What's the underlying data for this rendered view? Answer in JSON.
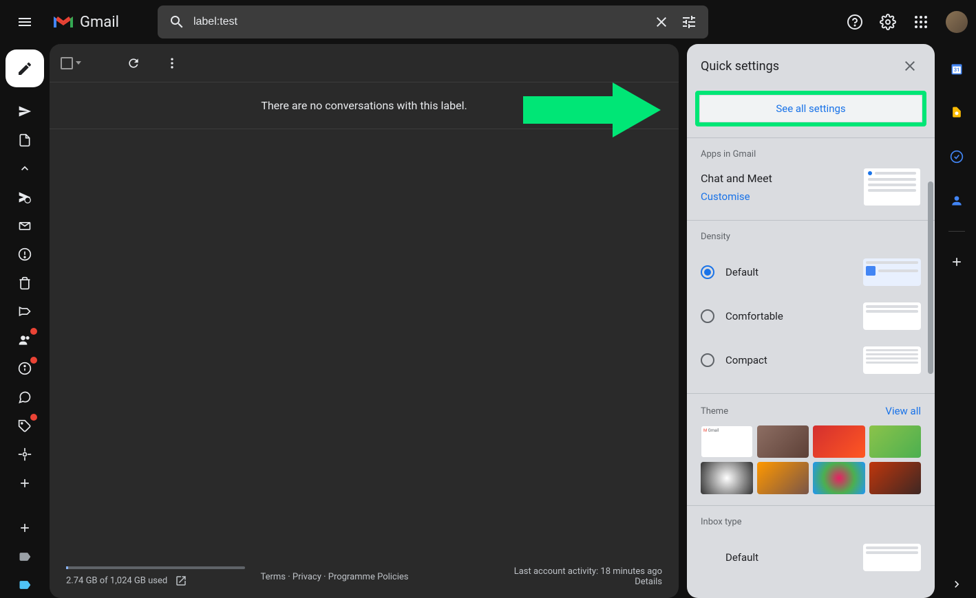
{
  "header": {
    "app_name": "Gmail",
    "search_value": "label:test"
  },
  "toolbar": {},
  "main": {
    "empty_message": "There are no conversations with this label."
  },
  "footer": {
    "storage": "2.74 GB of 1,024 GB used",
    "terms": "Terms",
    "privacy": "Privacy",
    "policies": "Programme Policies",
    "activity": "Last account activity: 18 minutes ago",
    "details": "Details"
  },
  "quick_settings": {
    "title": "Quick settings",
    "see_all": "See all settings",
    "apps_section": "Apps in Gmail",
    "chat_meet": "Chat and Meet",
    "customise": "Customise",
    "density_section": "Density",
    "density_options": {
      "default": "Default",
      "comfortable": "Comfortable",
      "compact": "Compact"
    },
    "theme_section": "Theme",
    "view_all": "View all",
    "inbox_type_section": "Inbox type",
    "inbox_default": "Default"
  },
  "annotation": {
    "arrow_color": "#00e676"
  }
}
